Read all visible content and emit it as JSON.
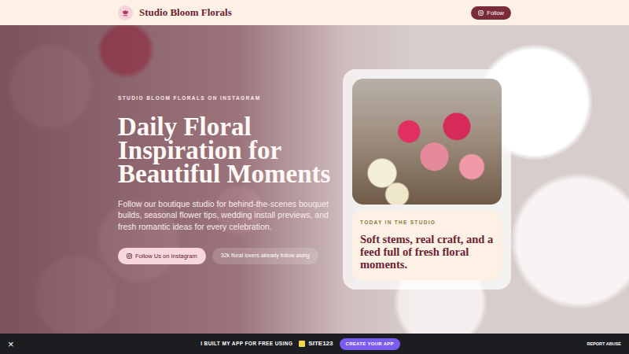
{
  "brand": {
    "name": "Studio Bloom Florals"
  },
  "nav": {
    "follow_button": "Follow"
  },
  "hero": {
    "eyebrow": "STUDIO BLOOM FLORALS ON INSTAGRAM",
    "title": "Daily Floral Inspiration for Beautiful Moments",
    "description": "Follow our boutique studio for behind-the-scenes bouquet builds, seasonal flower tips, wedding install previews, and fresh romantic ideas for every celebration.",
    "cta": "Follow Us on Instagram",
    "followers": "32k floral lovers already follow along"
  },
  "feature_card": {
    "eyebrow": "TODAY IN THE STUDIO",
    "text": "Soft stems, real craft, and a feed full of fresh floral moments."
  },
  "footer_bar": {
    "close": "×",
    "message": "I BUILT MY APP FOR FREE USING",
    "logo": "SITE123",
    "cta": "CREATE YOUR APP",
    "report": "REPORT ABUSE"
  }
}
